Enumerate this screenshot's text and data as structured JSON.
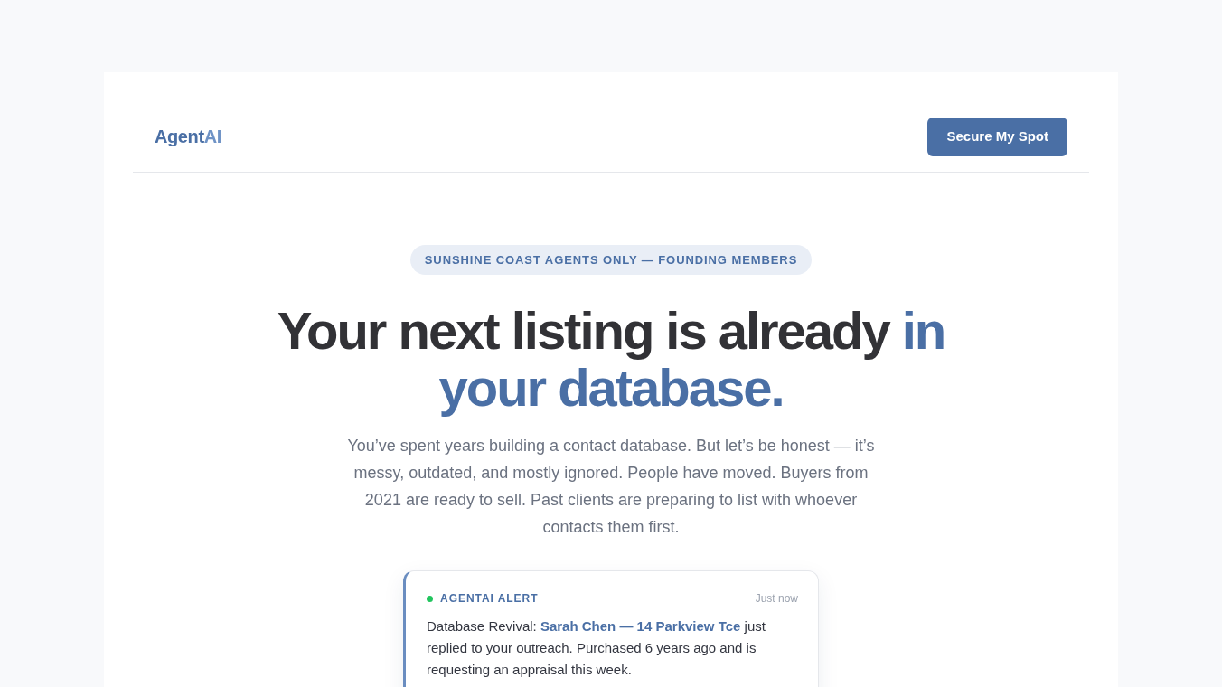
{
  "header": {
    "logo": {
      "text": "Agent",
      "accent": "AI"
    },
    "cta": "Secure My Spot"
  },
  "hero": {
    "badge": "SUNSHINE COAST AGENTS ONLY — FOUNDING MEMBERS",
    "headline": {
      "text": "Your next listing is already",
      "highlight": "in your database."
    },
    "intro": "You’ve spent years building a contact database. But let’s be honest — it’s messy, outdated, and mostly ignored. People have moved. Buyers from 2021 are ready to sell. Past clients are preparing to list with whoever contacts them first."
  },
  "alert": {
    "label": "AGENTAI ALERT",
    "time": "Just now",
    "body": {
      "prefix": "Database Revival:",
      "highlight": "Sarah Chen — 14 Parkview Tce",
      "suffix": "just replied to your outreach. Purchased 6 years ago and is requesting an appraisal this week."
    }
  }
}
